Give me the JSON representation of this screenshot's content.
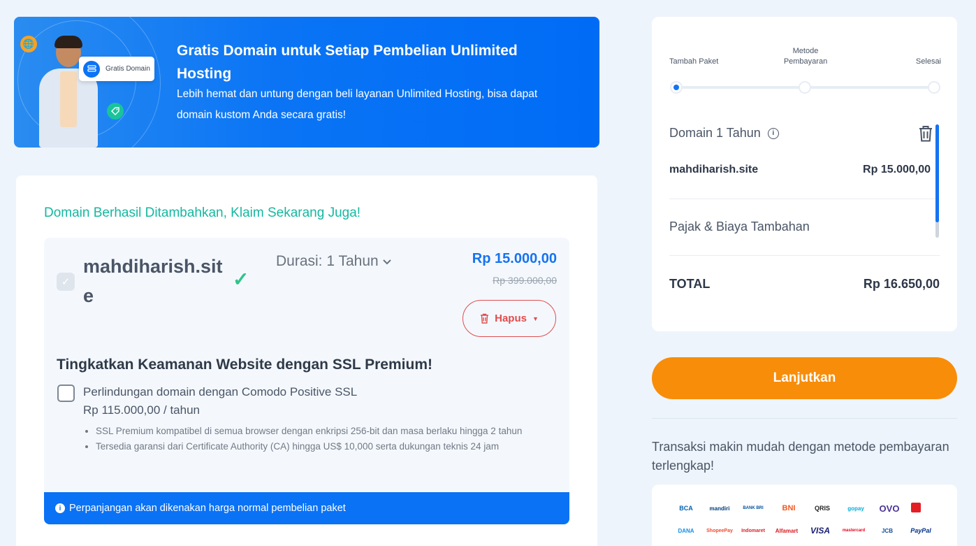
{
  "banner": {
    "tag_label": "Gratis Domain",
    "title": "Gratis Domain untuk Setiap Pembelian Unlimited Hosting",
    "description": "Lebih hemat dan untung dengan beli layanan Unlimited Hosting, bisa dapat domain kustom Anda secara gratis!"
  },
  "domain_card": {
    "success_message": "Domain Berhasil Ditambahkan, Klaim Sekarang Juga!",
    "domain_name": "mahdiharish.site",
    "duration": "Durasi: 1 Tahun",
    "price": "Rp 15.000,00",
    "old_price": "Rp 399.000,00",
    "delete_label": "Hapus",
    "ssl": {
      "title": "Tingkatkan Keamanan Website dengan SSL Premium!",
      "name": "Perlindungan domain dengan Comodo Positive SSL",
      "price": "Rp 115.000,00 / tahun",
      "features": [
        "SSL Premium kompatibel di semua browser dengan enkripsi 256-bit dan masa berlaku hingga 2 tahun",
        "Tersedia garansi dari Certificate Authority (CA) hingga US$ 10,000 serta dukungan teknis 24 jam"
      ]
    },
    "renewal_note": "Perpanjangan akan dikenakan harga normal pembelian paket"
  },
  "summary": {
    "steps": [
      {
        "label": "Tambah Paket",
        "active": true
      },
      {
        "label": "Metode Pembayaran",
        "active": false
      },
      {
        "label": "Selesai",
        "active": false
      }
    ],
    "domain_title": "Domain 1 Tahun",
    "domain_item": {
      "name": "mahdiharish.site",
      "price": "Rp 15.000,00"
    },
    "tax_label": "Pajak & Biaya Tambahan",
    "total_label": "TOTAL",
    "total_value": "Rp 16.650,00"
  },
  "continue_label": "Lanjutkan",
  "payment": {
    "text": "Transaksi makin mudah dengan metode pembayaran terlengkap!",
    "methods": [
      {
        "name": "BCA",
        "color": "#0060af"
      },
      {
        "name": "mandiri",
        "color": "#003d79"
      },
      {
        "name": "BANK BRI",
        "color": "#00529c"
      },
      {
        "name": "BNI",
        "color": "#f15a23"
      },
      {
        "name": "QRIS",
        "color": "#222222"
      },
      {
        "name": "gopay",
        "color": "#00aed6"
      },
      {
        "name": "OVO",
        "color": "#4c3494"
      },
      {
        "name": "Alfamart/other",
        "color": "#e31e24"
      },
      {
        "name": "DANA",
        "color": "#118eea"
      },
      {
        "name": "ShopeePay",
        "color": "#ee4d2d"
      },
      {
        "name": "Indomaret",
        "color": "#e31e24"
      },
      {
        "name": "Alfamart",
        "color": "#d71920"
      },
      {
        "name": "VISA",
        "color": "#1a1f71"
      },
      {
        "name": "mastercard",
        "color": "#eb001b"
      },
      {
        "name": "JCB",
        "color": "#0e4c96"
      },
      {
        "name": "PayPal",
        "color": "#003087"
      }
    ]
  }
}
